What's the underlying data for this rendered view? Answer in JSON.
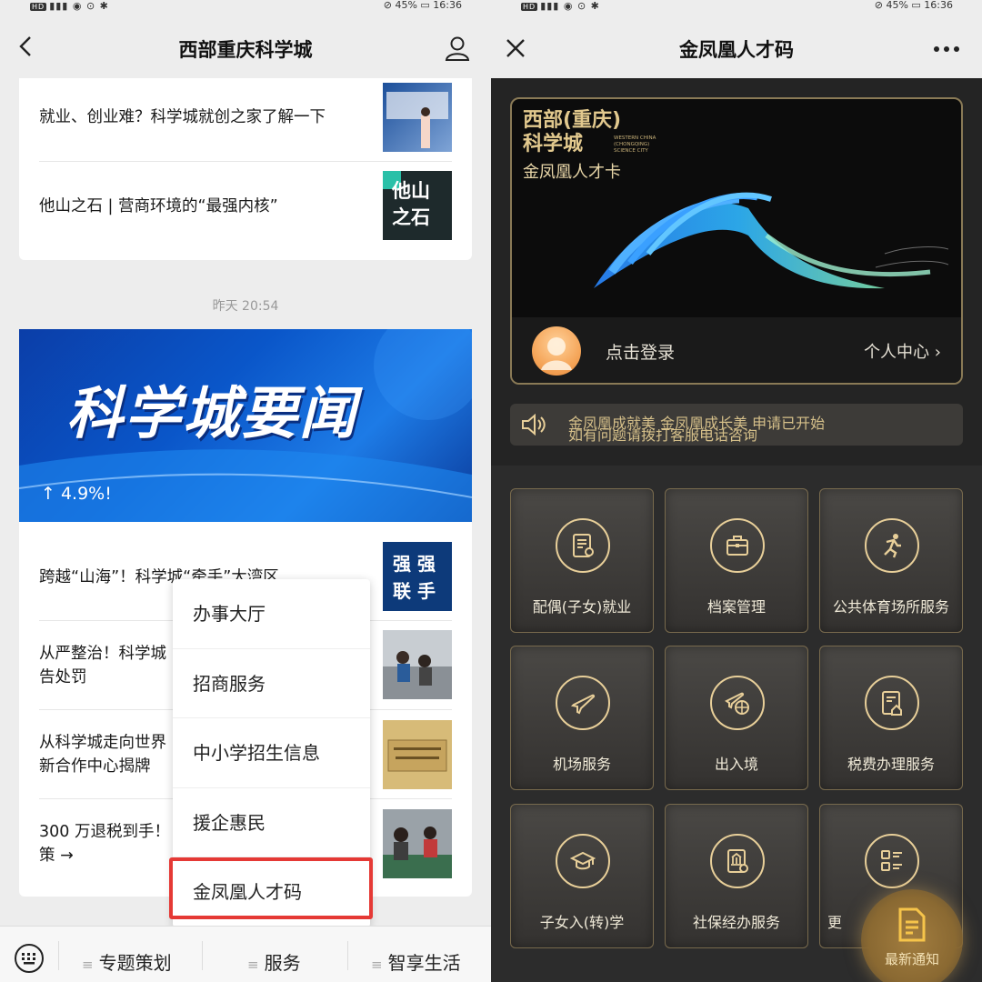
{
  "left": {
    "status": {
      "time": "16:36",
      "battery": "45%",
      "network": "HD"
    },
    "nav": {
      "title": "西部重庆科学城"
    },
    "top_articles": [
      {
        "title": "就业、创业难？科学城就创之家了解一下"
      },
      {
        "title": "他山之石 | 营商环境的“最强内核”",
        "thumb_text": [
          "他山",
          "之石"
        ]
      }
    ],
    "timestamp": "昨天 20:54",
    "banner": {
      "title": "科学城要闻",
      "subtitle": "↑ 4.9%!"
    },
    "articles": [
      {
        "title": "跨越“山海”！科学城“牵手”大湾区",
        "thumb_text": [
          "强 强",
          "联 手"
        ]
      },
      {
        "title_line1": "从严整治！科学城",
        "title_line2": "告处罚"
      },
      {
        "title_line1": "从科学城走向世界",
        "title_line2": "新合作中心揭牌"
      },
      {
        "title_line1": "300 万退税到手！",
        "title_line2": "策 →"
      }
    ],
    "popup_menu": [
      "办事大厅",
      "招商服务",
      "中小学招生信息",
      "援企惠民",
      "金凤凰人才码"
    ],
    "bottom_menu": [
      "专题策划",
      "服务",
      "智享生活"
    ]
  },
  "right": {
    "status": {
      "time": "16:36",
      "battery": "45%"
    },
    "nav": {
      "title": "金凤凰人才码"
    },
    "card": {
      "logo_line1": "西部(重庆)",
      "logo_line2": "科学城",
      "logo_en": [
        "WESTERN CHINA",
        "(CHONGQING)",
        "SCIENCE CITY"
      ],
      "subtitle": "金凤凰人才卡",
      "login_text": "点击登录",
      "personal_center": "个人中心"
    },
    "notice": {
      "line1": "金凤凰成就美 金凤凰成长美 申请已开始",
      "line2": "如有问题请拨打客服电话咨询"
    },
    "services": [
      {
        "label": "配偶(子女)就业",
        "icon": "id-card-icon"
      },
      {
        "label": "档案管理",
        "icon": "briefcase-icon"
      },
      {
        "label": "公共体育场所服务",
        "icon": "runner-icon"
      },
      {
        "label": "机场服务",
        "icon": "airplane-icon"
      },
      {
        "label": "出入境",
        "icon": "plane-globe-icon"
      },
      {
        "label": "税费办理服务",
        "icon": "tax-document-icon"
      },
      {
        "label": "子女入(转)学",
        "icon": "graduation-cap-icon"
      },
      {
        "label": "社保经办服务",
        "icon": "social-security-icon"
      },
      {
        "label": "更",
        "icon": "list-grid-icon"
      }
    ],
    "fab": {
      "label": "最新通知",
      "icon": "notice-document-icon"
    }
  },
  "colors": {
    "accent_gold": "#e8cf99",
    "highlight_red": "#e53935",
    "banner_blue": "#0a56c9"
  }
}
